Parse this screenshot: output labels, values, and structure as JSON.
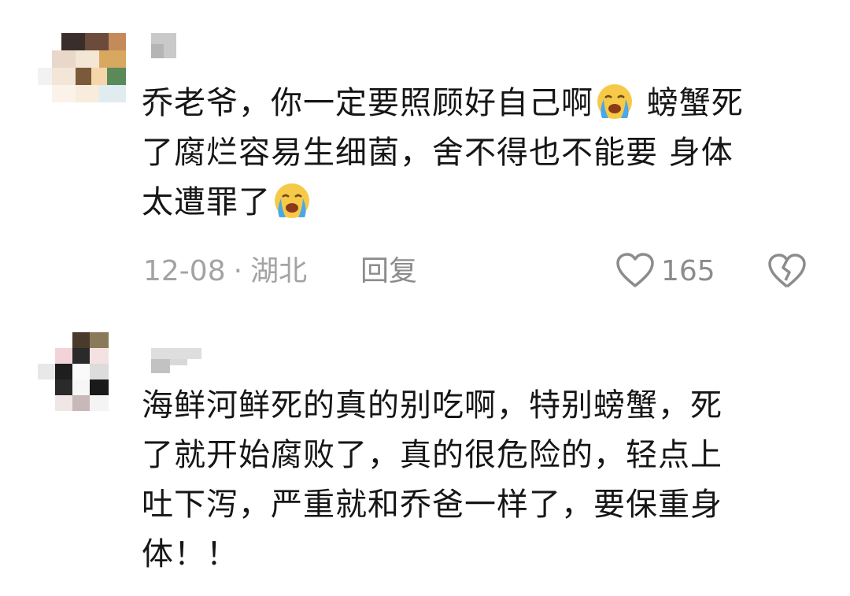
{
  "comments": [
    {
      "text_parts": [
        "乔老爷，你一定要照顾好自己啊",
        "loudly-crying-emoji",
        " 螃蟹死了腐烂容易生细菌，舍不得也不能要 身体太遭罪了",
        "loudly-crying-emoji"
      ],
      "text_1": "乔老爷，你一定要照顾好自己啊",
      "text_2": "螃蟹死",
      "text_3": "了腐烂容易生细菌，舍不得也不能要 身体",
      "text_4": "太遭罪了",
      "date": "12-08",
      "separator": "·",
      "location": "湖北",
      "reply_label": "回复",
      "like_count": "165",
      "icons": [
        "heart-icon",
        "broken-heart-icon"
      ]
    },
    {
      "line_1": "海鲜河鲜死的真的别吃啊，特别螃蟹，死",
      "line_2": "了就开始腐败了，真的很危险的，轻点上",
      "line_3": "吐下泻，严重就和乔爸一样了，要保重身",
      "line_4": "体！！"
    }
  ],
  "colors": {
    "text": "#161616",
    "meta": "#a3a3a3",
    "icon": "#8c8c8c",
    "emoji_face": "#f7c948",
    "emoji_tear": "#4aa8e8"
  }
}
